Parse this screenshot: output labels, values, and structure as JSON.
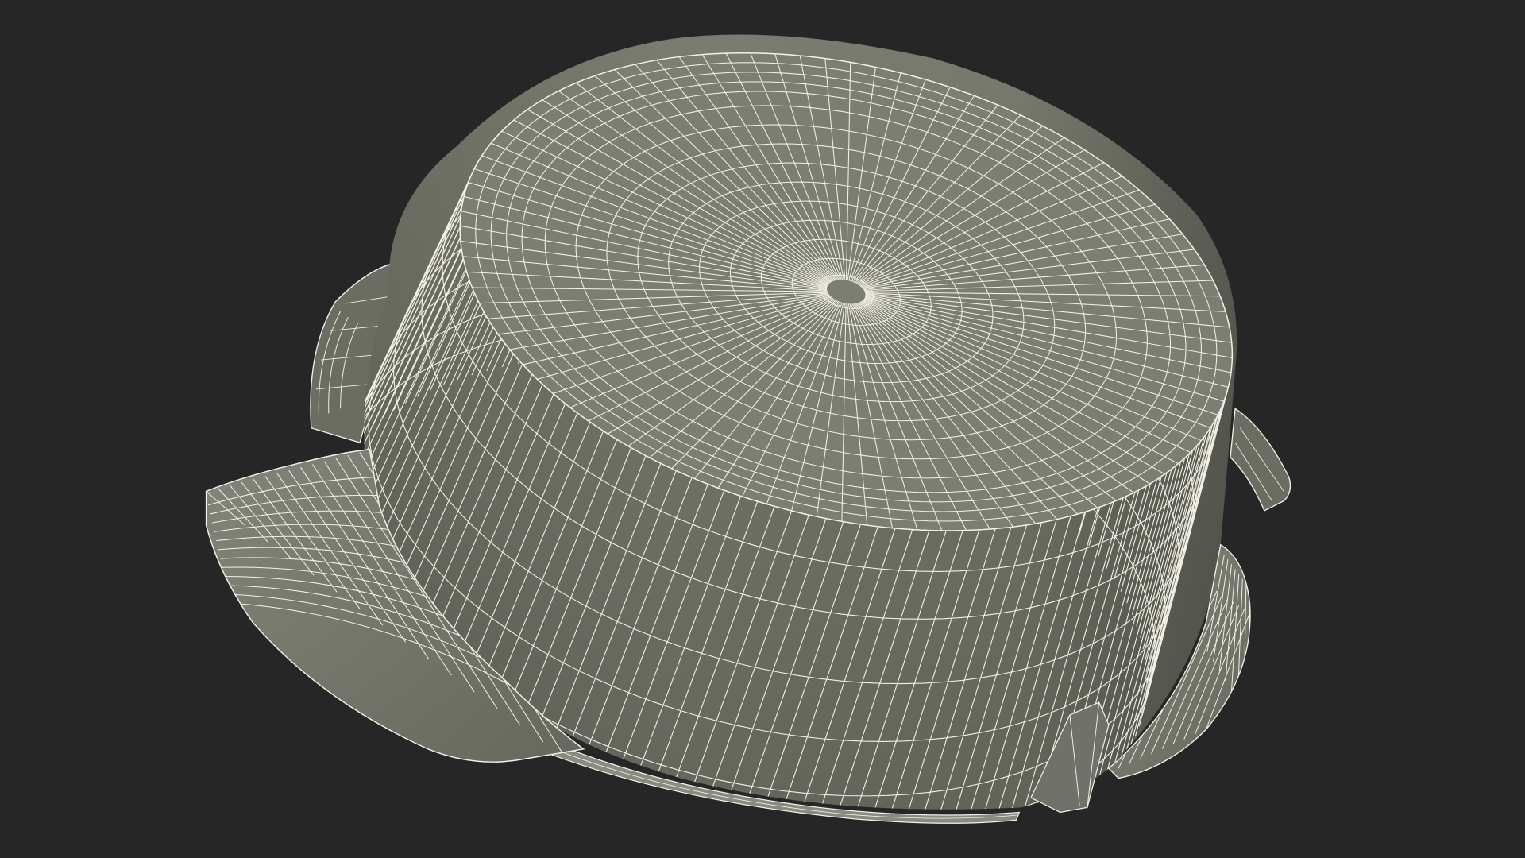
{
  "scene": {
    "subject": "wireframe-cooking-pot-upside-down",
    "background_color": "#262626",
    "mesh_fill_color": "#7b7c70",
    "mesh_shadow_color": "#55564d",
    "wire_color": "#f3f1e6"
  }
}
